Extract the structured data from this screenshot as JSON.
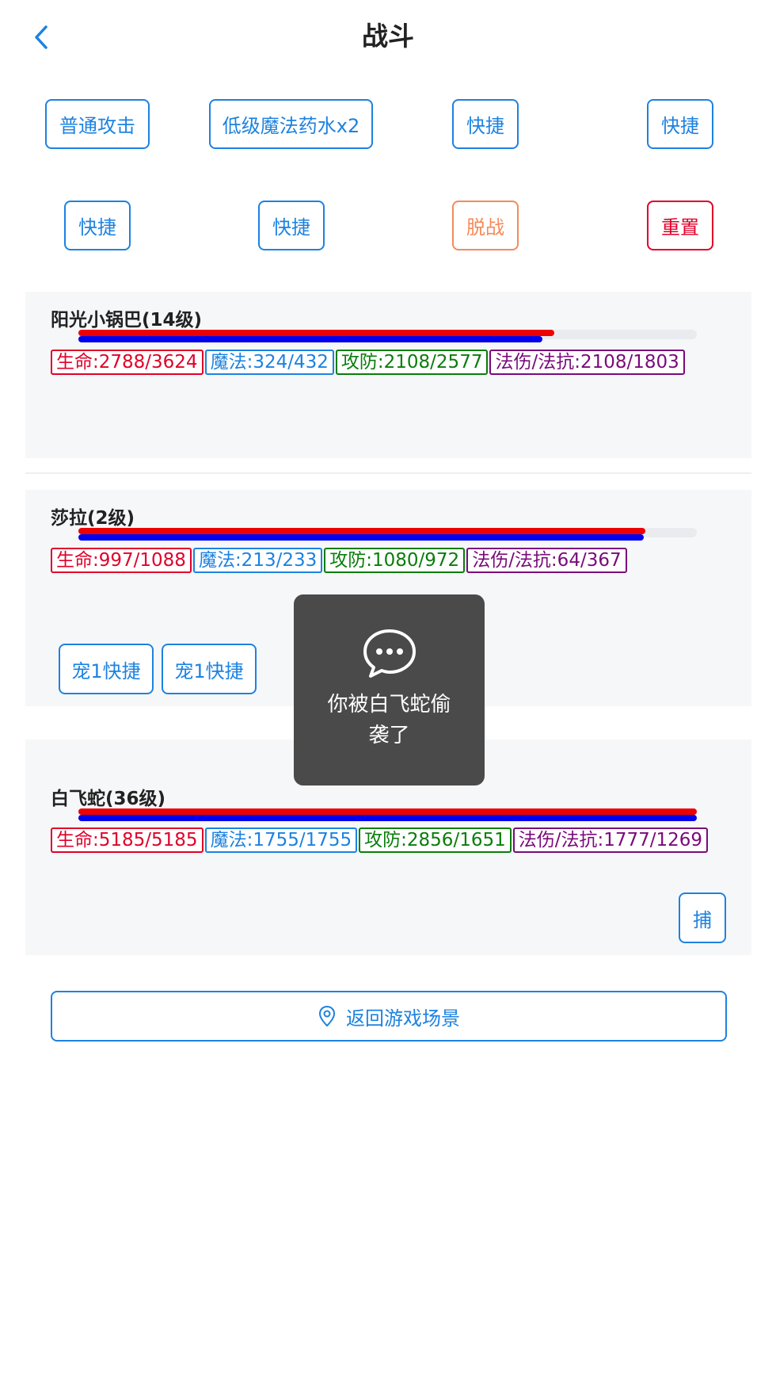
{
  "header": {
    "title": "战斗",
    "back_icon": "chevron-left-icon"
  },
  "actions_row1": [
    "普通攻击",
    "低级魔法药水x2",
    "快捷",
    "快捷"
  ],
  "actions_row2": [
    "快捷",
    "快捷",
    "脱战",
    "重置"
  ],
  "units": [
    {
      "name": "阳光小锅巴(14级)",
      "hp_fraction": 0.7693,
      "mp_fraction": 0.75,
      "stats": {
        "hp": "生命:2788/3624",
        "mp": "魔法:324/432",
        "atk": "攻防:2108/2577",
        "mag": "法伤/法抗:2108/1803"
      }
    },
    {
      "name": "莎拉(2级)",
      "hp_fraction": 0.9163,
      "mp_fraction": 0.9142,
      "stats": {
        "hp": "生命:997/1088",
        "mp": "魔法:213/233",
        "atk": "攻防:1080/972",
        "mag": "法伤/法抗:64/367"
      },
      "pet_buttons": [
        "宠1快捷",
        "宠1快捷"
      ]
    },
    {
      "name": "白飞蛇(36级)",
      "hp_fraction": 1.0,
      "mp_fraction": 1.0,
      "stats": {
        "hp": "生命:5185/5185",
        "mp": "魔法:1755/1755",
        "atk": "攻防:2856/1651",
        "mag": "法伤/法抗:1777/1269"
      },
      "capture_label": "捕"
    }
  ],
  "toast": {
    "icon": "chat-bubble-icon",
    "message": "你被白飞蛇偷袭了"
  },
  "footer": {
    "return_label": "返回游戏场景",
    "icon": "location-pin-icon"
  },
  "colors": {
    "accent": "#1d82e0",
    "hp": "#ee0000",
    "mp": "#0000ee",
    "escape": "#f58a5a",
    "reset": "#e0002a"
  }
}
